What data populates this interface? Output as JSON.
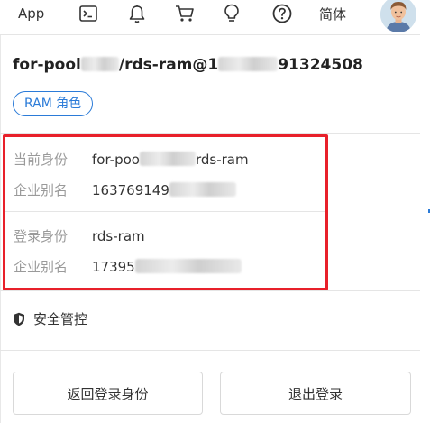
{
  "topbar": {
    "app_label": "App",
    "language_label": "简体",
    "icons": [
      "terminal-icon",
      "bell-icon",
      "cart-icon",
      "lightbulb-icon",
      "help-icon",
      "avatar"
    ]
  },
  "account": {
    "name_prefix": "for-pool",
    "name_middle": "/rds-ram@1",
    "name_suffix": "91324508",
    "role_badge": "RAM 角色"
  },
  "current_identity": {
    "label": "当前身份",
    "value_prefix": "for-poo",
    "value_suffix": "rds-ram",
    "alias_label": "企业别名",
    "alias_value": "163769149"
  },
  "login_identity": {
    "label": "登录身份",
    "value": "rds-ram",
    "alias_label": "企业别名",
    "alias_value": "17395"
  },
  "security": {
    "label": "安全管控",
    "icon": "shield-icon"
  },
  "buttons": {
    "back": "返回登录身份",
    "logout": "退出登录"
  },
  "colors": {
    "accent": "#2b7bd8",
    "highlight": "#e8202a"
  }
}
